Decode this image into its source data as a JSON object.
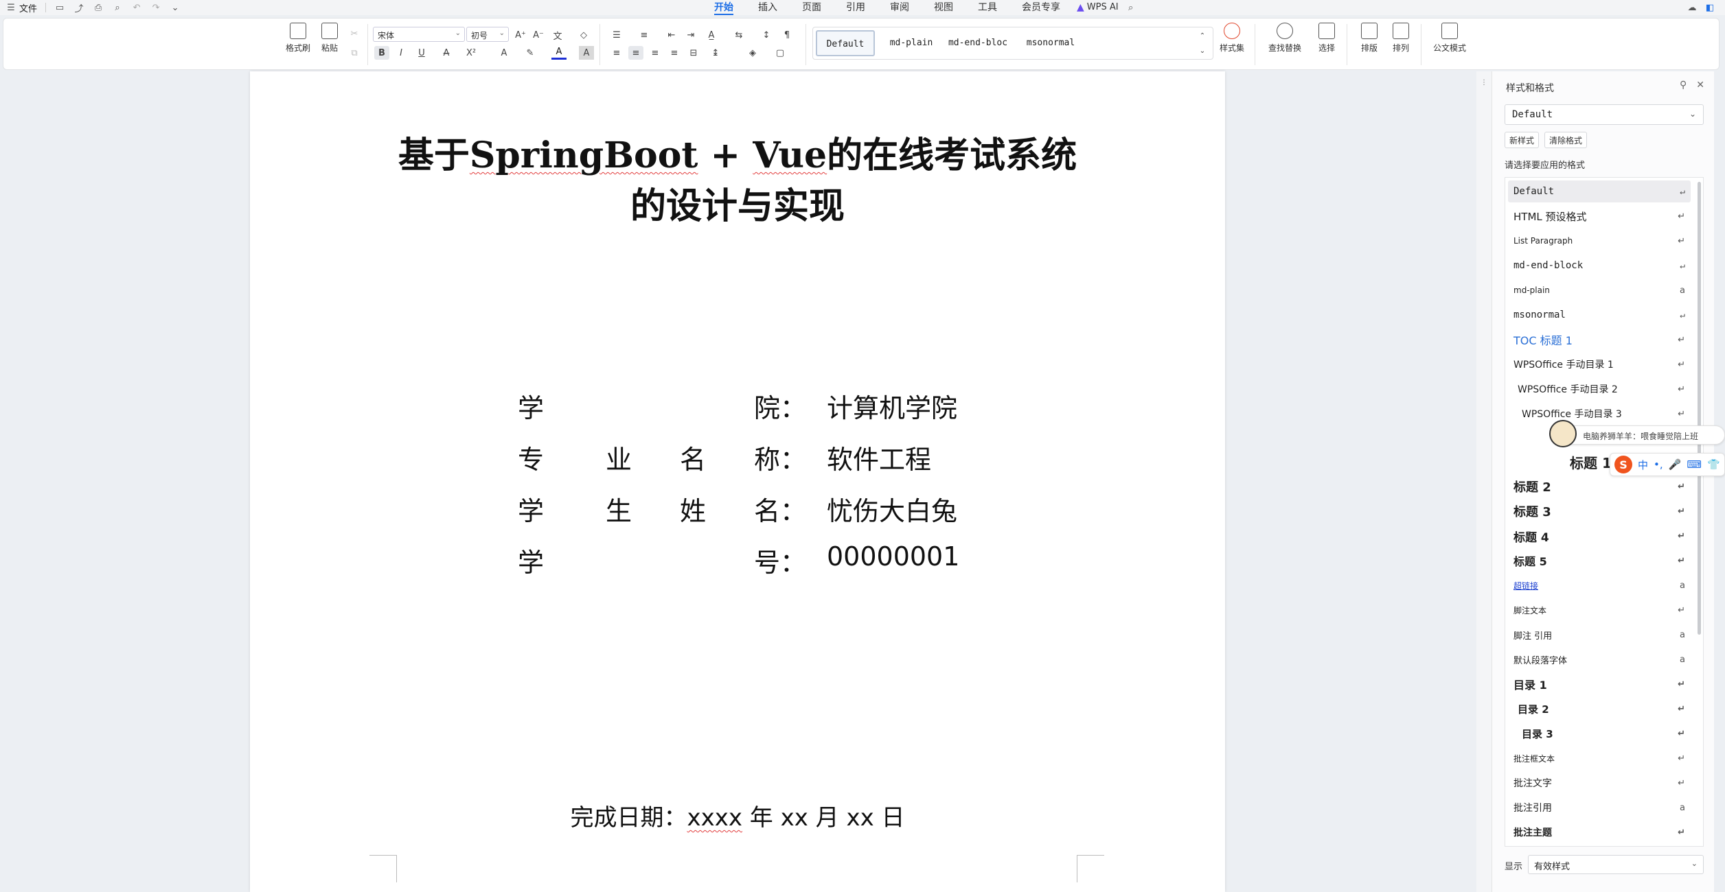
{
  "menubar": {
    "file_label": "文件",
    "tabs": [
      "开始",
      "插入",
      "页面",
      "引用",
      "审阅",
      "视图",
      "工具",
      "会员专享"
    ],
    "active_tab": "开始",
    "wps_ai": "WPS AI"
  },
  "ribbon": {
    "format_painter": "格式刷",
    "paste": "粘贴",
    "font_name": "宋体",
    "font_size": "初号",
    "style_gallery": [
      "Default",
      "md-plain",
      "md-end-bloc",
      "msonormal"
    ],
    "style_set": "样式集",
    "find_replace": "查找替换",
    "select": "选择",
    "layout": "排版",
    "arrange": "排列",
    "official_mode": "公文模式"
  },
  "document": {
    "title_line1_a": "基于",
    "title_line1_b": "SpringBoot",
    "title_line1_c": " + ",
    "title_line1_d": "Vue",
    "title_line1_e": "的在线考试系统",
    "title_line2": "的设计与实现",
    "rows": [
      {
        "c1": "学",
        "c2": "",
        "c3": "",
        "c4": "院：",
        "value": "计算机学院"
      },
      {
        "c1": "专",
        "c2": "业",
        "c3": "名",
        "c4": "称：",
        "value": "软件工程"
      },
      {
        "c1": "学",
        "c2": "生",
        "c3": "姓",
        "c4": "名：",
        "value": "忧伤大白兔"
      },
      {
        "c1": "学",
        "c2": "",
        "c3": "",
        "c4": "号：",
        "value": "00000001"
      }
    ],
    "date_prefix": "完成日期：",
    "date_year": "xxxx",
    "date_rest": "年 xx 月 xx 日"
  },
  "panel": {
    "title": "样式和格式",
    "current_style": "Default",
    "new_style": "新样式",
    "clear_format": "清除格式",
    "hint": "请选择要应用的格式",
    "styles": [
      {
        "label": "Default",
        "mark": "↵"
      },
      {
        "label": "HTML 预设格式",
        "mark": "↵"
      },
      {
        "label": "List Paragraph",
        "mark": "↵"
      },
      {
        "label": "md-end-block",
        "mark": "↵"
      },
      {
        "label": "md-plain",
        "mark": "a"
      },
      {
        "label": "msonormal",
        "mark": "↵"
      },
      {
        "label": "TOC 标题 1",
        "mark": "↵"
      },
      {
        "label": "WPSOffice 手动目录 1",
        "mark": "↵"
      },
      {
        "label": "WPSOffice 手动目录 2",
        "mark": "↵"
      },
      {
        "label": "WPSOffice 手动目录 3",
        "mark": "↵"
      },
      {
        "label": "标题 1",
        "mark": ""
      },
      {
        "label": "标题 2",
        "mark": "↵"
      },
      {
        "label": "标题 3",
        "mark": "↵"
      },
      {
        "label": "标题 4",
        "mark": "↵"
      },
      {
        "label": "标题 5",
        "mark": "↵"
      },
      {
        "label": "超链接",
        "mark": "a"
      },
      {
        "label": "脚注文本",
        "mark": "↵"
      },
      {
        "label": "脚注 引用",
        "mark": "a"
      },
      {
        "label": "默认段落字体",
        "mark": "a"
      },
      {
        "label": "目录 1",
        "mark": "↵"
      },
      {
        "label": "目录 2",
        "mark": "↵"
      },
      {
        "label": "目录 3",
        "mark": "↵"
      },
      {
        "label": "批注框文本",
        "mark": "↵"
      },
      {
        "label": "批注文字",
        "mark": "↵"
      },
      {
        "label": "批注引用",
        "mark": "a"
      },
      {
        "label": "批注主题",
        "mark": "↵"
      }
    ],
    "display_label": "显示",
    "display_value": "有效样式"
  },
  "ime": {
    "tip": "电脑养狮羊羊：喂食睡觉陪上班",
    "logo": "S",
    "mode": "中"
  },
  "colors": {
    "accent": "#1d6ee6",
    "spell_underline": "#e23c3c",
    "toc_blue": "#2a6fd6",
    "hyperlink": "#1a3fcf"
  }
}
